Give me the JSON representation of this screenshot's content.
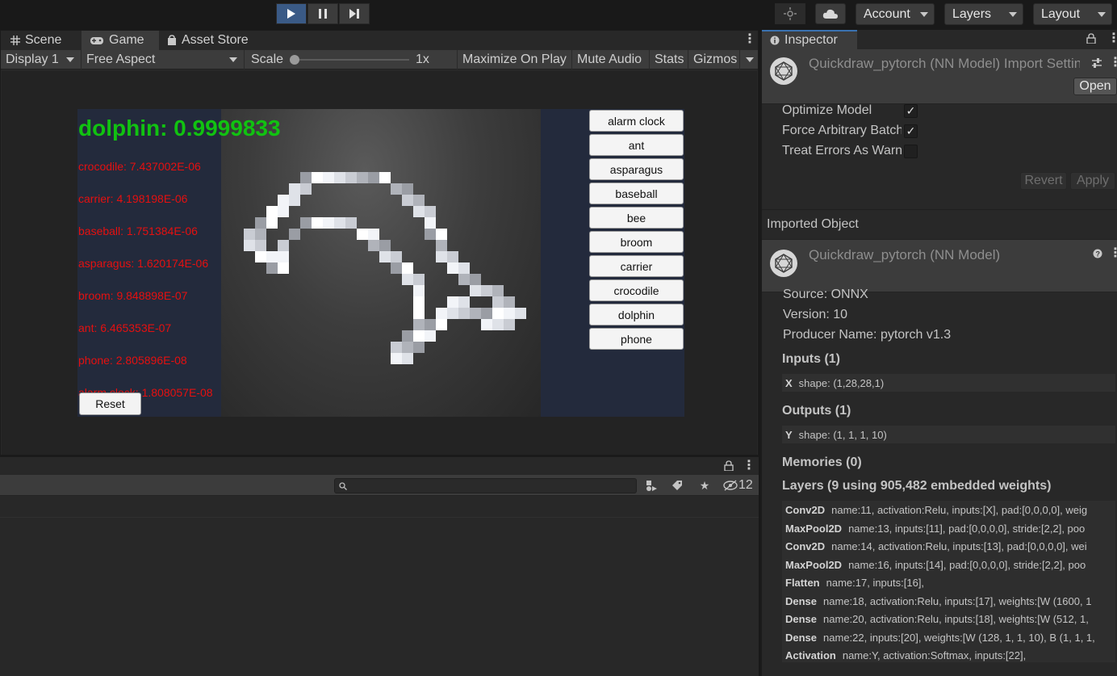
{
  "toolbar": {
    "account_label": "Account",
    "layers_label": "Layers",
    "layout_label": "Layout"
  },
  "game_panel": {
    "tabs": [
      "Scene",
      "Game",
      "Asset Store"
    ],
    "display": "Display 1",
    "aspect": "Free Aspect",
    "scale_label": "Scale",
    "scale_value": "1x",
    "scale_level": 0.0,
    "toggles": [
      "Maximize On Play",
      "Mute Audio",
      "Stats",
      "Gizmos"
    ]
  },
  "game": {
    "top_prediction": "dolphin: 0.9999833",
    "predictions": [
      "crocodile: 7.437002E-06",
      "carrier: 4.198198E-06",
      "baseball: 1.751384E-06",
      "asparagus: 1.620174E-06",
      "broom: 9.848898E-07",
      "ant: 6.465353E-07",
      "phone: 2.805896E-08",
      "alarm clock: 1.808057E-08"
    ],
    "reset_label": "Reset",
    "categories": [
      "alarm clock",
      "ant",
      "asparagus",
      "baseball",
      "bee",
      "broom",
      "carrier",
      "crocodile",
      "dolphin",
      "phone"
    ]
  },
  "bottom_panel": {
    "hidden_count": "12",
    "search_placeholder": ""
  },
  "inspector": {
    "tab_label": "Inspector",
    "title": "Quickdraw_pytorch (NN Model) Import Settings",
    "open_label": "Open",
    "options": [
      {
        "label": "Optimize Model",
        "checked": true
      },
      {
        "label": "Force Arbitrary Batch Size",
        "checked": true
      },
      {
        "label": "Treat Errors As Warnings",
        "checked": false
      }
    ],
    "revert_label": "Revert",
    "apply_label": "Apply",
    "imported_object_label": "Imported Object",
    "model_title": "Quickdraw_pytorch (NN Model)",
    "source": "Source: ONNX",
    "version": "Version: 10",
    "producer": "Producer Name: pytorch v1.3",
    "inputs_head": "Inputs (1)",
    "inputs": [
      {
        "name": "X",
        "desc": "shape: (1,28,28,1)"
      }
    ],
    "outputs_head": "Outputs (1)",
    "outputs": [
      {
        "name": "Y",
        "desc": "shape: (1, 1, 1, 10)"
      }
    ],
    "memories_head": "Memories (0)",
    "layers_head": "Layers (9 using 905,482 embedded weights)",
    "layers": [
      {
        "type": "Conv2D",
        "desc": "name:11, activation:Relu, inputs:[X], pad:[0,0,0,0], weig"
      },
      {
        "type": "MaxPool2D",
        "desc": "name:13, inputs:[11], pad:[0,0,0,0], stride:[2,2], poo"
      },
      {
        "type": "Conv2D",
        "desc": "name:14, activation:Relu, inputs:[13], pad:[0,0,0,0], wei"
      },
      {
        "type": "MaxPool2D",
        "desc": "name:16, inputs:[14], pad:[0,0,0,0], stride:[2,2], poo"
      },
      {
        "type": "Flatten",
        "desc": "name:17, inputs:[16],"
      },
      {
        "type": "Dense",
        "desc": "name:18, activation:Relu, inputs:[17], weights:[W (1600, 1"
      },
      {
        "type": "Dense",
        "desc": "name:20, activation:Relu, inputs:[18], weights:[W (512, 1,"
      },
      {
        "type": "Dense",
        "desc": "name:22, inputs:[20], weights:[W (128, 1, 1, 10), B (1, 1, 1,"
      },
      {
        "type": "Activation",
        "desc": "name:Y, activation:Softmax, inputs:[22],"
      }
    ]
  },
  "colors": {
    "accent": "#3a72b0",
    "top_prediction": "#11c211",
    "prediction_text": "#e51010"
  }
}
